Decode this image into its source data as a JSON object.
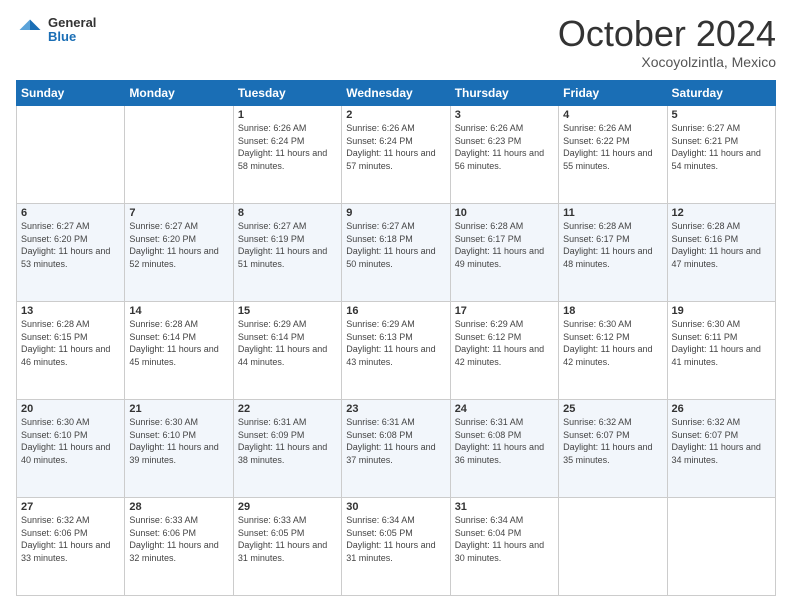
{
  "header": {
    "logo": {
      "general": "General",
      "blue": "Blue"
    },
    "month_title": "October 2024",
    "location": "Xocoyolzintla, Mexico"
  },
  "weekdays": [
    "Sunday",
    "Monday",
    "Tuesday",
    "Wednesday",
    "Thursday",
    "Friday",
    "Saturday"
  ],
  "weeks": [
    [
      {
        "day": "",
        "info": ""
      },
      {
        "day": "",
        "info": ""
      },
      {
        "day": "1",
        "info": "Sunrise: 6:26 AM\nSunset: 6:24 PM\nDaylight: 11 hours and 58 minutes."
      },
      {
        "day": "2",
        "info": "Sunrise: 6:26 AM\nSunset: 6:24 PM\nDaylight: 11 hours and 57 minutes."
      },
      {
        "day": "3",
        "info": "Sunrise: 6:26 AM\nSunset: 6:23 PM\nDaylight: 11 hours and 56 minutes."
      },
      {
        "day": "4",
        "info": "Sunrise: 6:26 AM\nSunset: 6:22 PM\nDaylight: 11 hours and 55 minutes."
      },
      {
        "day": "5",
        "info": "Sunrise: 6:27 AM\nSunset: 6:21 PM\nDaylight: 11 hours and 54 minutes."
      }
    ],
    [
      {
        "day": "6",
        "info": "Sunrise: 6:27 AM\nSunset: 6:20 PM\nDaylight: 11 hours and 53 minutes."
      },
      {
        "day": "7",
        "info": "Sunrise: 6:27 AM\nSunset: 6:20 PM\nDaylight: 11 hours and 52 minutes."
      },
      {
        "day": "8",
        "info": "Sunrise: 6:27 AM\nSunset: 6:19 PM\nDaylight: 11 hours and 51 minutes."
      },
      {
        "day": "9",
        "info": "Sunrise: 6:27 AM\nSunset: 6:18 PM\nDaylight: 11 hours and 50 minutes."
      },
      {
        "day": "10",
        "info": "Sunrise: 6:28 AM\nSunset: 6:17 PM\nDaylight: 11 hours and 49 minutes."
      },
      {
        "day": "11",
        "info": "Sunrise: 6:28 AM\nSunset: 6:17 PM\nDaylight: 11 hours and 48 minutes."
      },
      {
        "day": "12",
        "info": "Sunrise: 6:28 AM\nSunset: 6:16 PM\nDaylight: 11 hours and 47 minutes."
      }
    ],
    [
      {
        "day": "13",
        "info": "Sunrise: 6:28 AM\nSunset: 6:15 PM\nDaylight: 11 hours and 46 minutes."
      },
      {
        "day": "14",
        "info": "Sunrise: 6:28 AM\nSunset: 6:14 PM\nDaylight: 11 hours and 45 minutes."
      },
      {
        "day": "15",
        "info": "Sunrise: 6:29 AM\nSunset: 6:14 PM\nDaylight: 11 hours and 44 minutes."
      },
      {
        "day": "16",
        "info": "Sunrise: 6:29 AM\nSunset: 6:13 PM\nDaylight: 11 hours and 43 minutes."
      },
      {
        "day": "17",
        "info": "Sunrise: 6:29 AM\nSunset: 6:12 PM\nDaylight: 11 hours and 42 minutes."
      },
      {
        "day": "18",
        "info": "Sunrise: 6:30 AM\nSunset: 6:12 PM\nDaylight: 11 hours and 42 minutes."
      },
      {
        "day": "19",
        "info": "Sunrise: 6:30 AM\nSunset: 6:11 PM\nDaylight: 11 hours and 41 minutes."
      }
    ],
    [
      {
        "day": "20",
        "info": "Sunrise: 6:30 AM\nSunset: 6:10 PM\nDaylight: 11 hours and 40 minutes."
      },
      {
        "day": "21",
        "info": "Sunrise: 6:30 AM\nSunset: 6:10 PM\nDaylight: 11 hours and 39 minutes."
      },
      {
        "day": "22",
        "info": "Sunrise: 6:31 AM\nSunset: 6:09 PM\nDaylight: 11 hours and 38 minutes."
      },
      {
        "day": "23",
        "info": "Sunrise: 6:31 AM\nSunset: 6:08 PM\nDaylight: 11 hours and 37 minutes."
      },
      {
        "day": "24",
        "info": "Sunrise: 6:31 AM\nSunset: 6:08 PM\nDaylight: 11 hours and 36 minutes."
      },
      {
        "day": "25",
        "info": "Sunrise: 6:32 AM\nSunset: 6:07 PM\nDaylight: 11 hours and 35 minutes."
      },
      {
        "day": "26",
        "info": "Sunrise: 6:32 AM\nSunset: 6:07 PM\nDaylight: 11 hours and 34 minutes."
      }
    ],
    [
      {
        "day": "27",
        "info": "Sunrise: 6:32 AM\nSunset: 6:06 PM\nDaylight: 11 hours and 33 minutes."
      },
      {
        "day": "28",
        "info": "Sunrise: 6:33 AM\nSunset: 6:06 PM\nDaylight: 11 hours and 32 minutes."
      },
      {
        "day": "29",
        "info": "Sunrise: 6:33 AM\nSunset: 6:05 PM\nDaylight: 11 hours and 31 minutes."
      },
      {
        "day": "30",
        "info": "Sunrise: 6:34 AM\nSunset: 6:05 PM\nDaylight: 11 hours and 31 minutes."
      },
      {
        "day": "31",
        "info": "Sunrise: 6:34 AM\nSunset: 6:04 PM\nDaylight: 11 hours and 30 minutes."
      },
      {
        "day": "",
        "info": ""
      },
      {
        "day": "",
        "info": ""
      }
    ]
  ]
}
